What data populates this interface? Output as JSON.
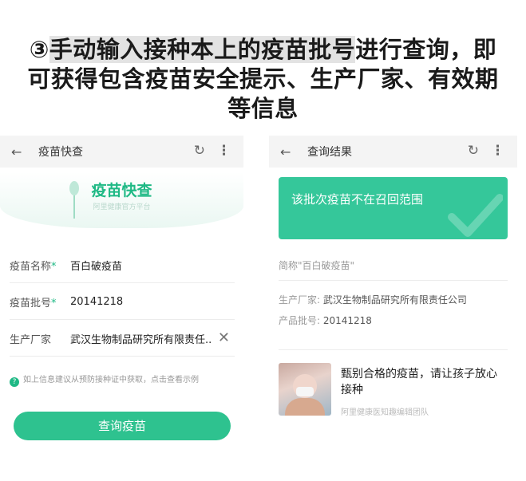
{
  "caption": {
    "line1_prefix": "③",
    "line1_highlight": "手动输入接种本上的疫苗批号",
    "line1_suffix": "进行查询，即",
    "line2": "可获得包含疫苗安全提示、生产厂家、有效期",
    "line3": "等信息"
  },
  "left_screen": {
    "topbar": {
      "back_glyph": "←",
      "title": "疫苗快查",
      "refresh_glyph": "↻",
      "more_glyph": "⋮"
    },
    "banner": {
      "title": "疫苗快查",
      "subtitle": "阿里健康官方平台"
    },
    "form": {
      "vaccine_name": {
        "label": "疫苗名称",
        "required_mark": "*",
        "value": "百白破疫苗"
      },
      "batch_number": {
        "label": "疫苗批号",
        "required_mark": "*",
        "value": "20141218"
      },
      "manufacturer": {
        "label": "生产厂家",
        "value": "武汉生物制品研究所有限责任..",
        "clear_glyph": "✕"
      }
    },
    "hint": {
      "icon": "?",
      "text": "如上信息建议从预防接种证中获取，点击查看示例"
    },
    "query_button": "查询疫苗"
  },
  "right_screen": {
    "topbar": {
      "back_glyph": "←",
      "title": "查询结果",
      "refresh_glyph": "↻",
      "more_glyph": "⋮"
    },
    "result_card": {
      "text": "该批次疫苗不在召回范围",
      "color": "#35c79a"
    },
    "short_name": "简称\"百白破疫苗\"",
    "manufacturer": {
      "label": "生产厂家: ",
      "value": "武汉生物制品研究所有限责任公司"
    },
    "batch": {
      "label": "产品批号: ",
      "value": "20141218"
    },
    "article": {
      "title": "甄别合格的疫苗，请让孩子放心接种",
      "source": "阿里健康医知趣编辑团队"
    }
  },
  "colors": {
    "accent": "#2ec28f",
    "brand_text": "#1fb985"
  }
}
